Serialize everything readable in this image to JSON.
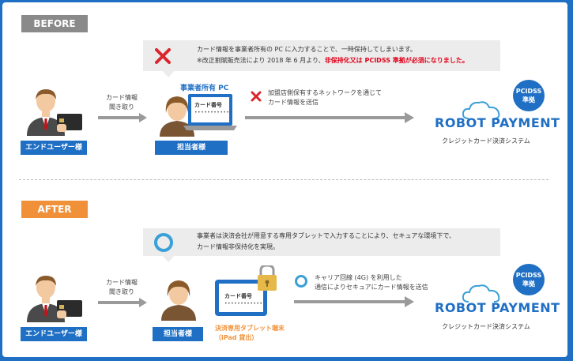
{
  "before": {
    "tag": "BEFORE",
    "callout_line1": "カード情報を事業者所有の PC に入力することで、一時保持してしまいます。",
    "callout_line2_prefix": "※改正割賦販売法により 2018 年 6 月より、",
    "callout_line2_warning": "非保持化又は PCIDSS 準拠が必須になりました。",
    "pc_label": "事業者所有 PC",
    "pc_screen_title": "カード番号",
    "pc_screen_mask": "••••••••••••",
    "end_user_label": "エンドユーザー様",
    "hearing_line1": "カード情報",
    "hearing_line2": "聞き取り",
    "staff_label": "担当者様",
    "network_line1": "加盟店側保有するネットワークを通じて",
    "network_line2": "カード情報を送信",
    "pcidss_line1": "PCIDSS",
    "pcidss_line2": "準拠",
    "brand_name": "ROBOT PAYMENT",
    "brand_sub": "クレジットカード決済システム"
  },
  "after": {
    "tag": "AFTER",
    "callout_line1": "事業者は決済会社が用意する専用タブレットで入力することにより、セキュアな環境下で、",
    "callout_line2": "カード情報非保持化を実現。",
    "end_user_label": "エンドユーザー様",
    "hearing_line1": "カード情報",
    "hearing_line2": "聞き取り",
    "staff_label": "担当者様",
    "tablet_title": "カード番号",
    "tablet_mask": "••••••••••••",
    "tablet_line1": "決済専用タブレット端末",
    "tablet_line2": "（iPad 貸出）",
    "carrier_line1": "キャリア回線 (4G) を利用した",
    "carrier_line2": "通信によりセキュアにカード情報を送信",
    "pcidss_line1": "PCIDSS",
    "pcidss_line2": "準拠",
    "brand_name": "ROBOT PAYMENT",
    "brand_sub": "クレジットカード決済システム"
  },
  "colors": {
    "blue": "#1f6fc4",
    "before_tag": "#8a8a8a",
    "after_tag": "#f0913a",
    "warning_red": "#e0001a",
    "x_red": "#d9262c",
    "circle_blue": "#3aa0d8",
    "tablet_orange": "#f0913a"
  }
}
